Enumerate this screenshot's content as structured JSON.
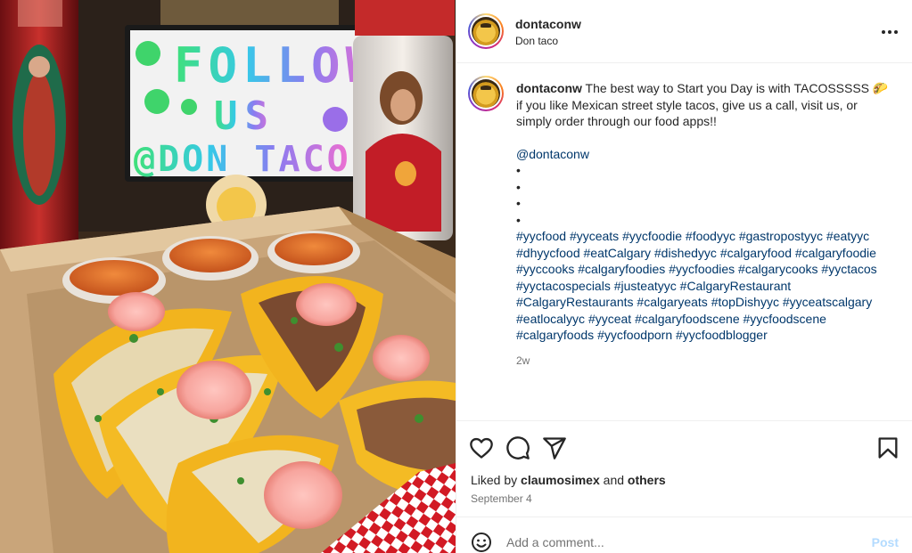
{
  "post": {
    "username": "dontaconw",
    "location": "Don taco",
    "more_icon": "more-horizontal-icon",
    "photo": {
      "lightbox_line1": "FOLLOW",
      "lightbox_line2": "US",
      "lightbox_line3": "@DON TACO"
    },
    "caption": {
      "username": "dontaconw",
      "text": "The best way to Start you Day is with TACOSSSSS 🌮 if you like Mexican street style tacos, give us a call, visit us, or simply order through our food apps!!",
      "mention": "@dontaconw",
      "bullets": [
        "•",
        "•",
        "•",
        "•"
      ],
      "hashtags": [
        "#yycfood",
        "#yyceats",
        "#yycfoodie",
        "#foodyyc",
        "#gastropostyyc",
        "#eatyyc",
        "#dhyycfood",
        "#eatCalgary",
        "#dishedyyc",
        " #calgaryfood",
        "#calgaryfoodie",
        "#yyccooks",
        "#calgaryfoodies",
        "#yycfoodies",
        "#calgarycooks",
        "#yyctacos",
        "#yyctacospecials",
        "#justeatyyc",
        "#CalgaryRestaurant",
        "#CalgaryRestaurants",
        "#calgaryeats",
        "#topDishyyc",
        "#yyceatscalgary",
        "#eatlocalyyc",
        "#yyceat",
        "#calgaryfoodscene",
        "#yycfoodscene",
        "#calgaryfoods",
        "#yycfoodporn",
        "#yycfoodblogger"
      ],
      "time_ago": "2w"
    },
    "actions": {
      "like_icon": "heart-icon",
      "comment_icon": "comment-icon",
      "share_icon": "share-icon",
      "save_icon": "bookmark-icon"
    },
    "likes": {
      "prefix": "Liked by",
      "user": "claumosimex",
      "conj": "and",
      "others": "others"
    },
    "date": "September 4",
    "comment": {
      "placeholder": "Add a comment...",
      "post_label": "Post",
      "emoji_icon": "emoji-icon"
    }
  }
}
